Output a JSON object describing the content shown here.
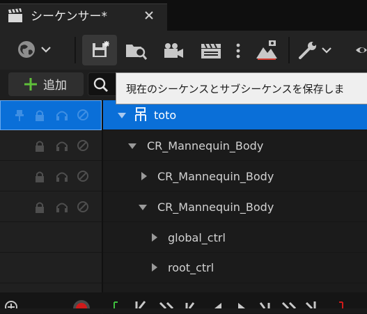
{
  "tab": {
    "title": "シーケンサー*",
    "icon": "clapperboard-icon"
  },
  "toolbar": {
    "buttons": [
      {
        "icon": "world-icon"
      },
      {
        "icon": "save-icon"
      },
      {
        "icon": "browse-icon"
      },
      {
        "icon": "camera-icon"
      },
      {
        "icon": "clapperboard-icon"
      },
      {
        "icon": "more-icon"
      },
      {
        "icon": "render-icon"
      },
      {
        "icon": "wrench-icon"
      },
      {
        "icon": "eye-icon"
      }
    ]
  },
  "filter": {
    "add_label": "追加"
  },
  "tooltip": {
    "text": "現在のシーケンスとサブシーケンスを保存しま"
  },
  "tree": {
    "rows": [
      {
        "label": "toto",
        "expanded": true,
        "selected": true,
        "icon": "sequence-icon"
      },
      {
        "label": "CR_Mannequin_Body",
        "expanded": true
      },
      {
        "label": "CR_Mannequin_Body",
        "expanded": false
      },
      {
        "label": "CR_Mannequin_Body",
        "expanded": true
      },
      {
        "label": "global_ctrl",
        "expanded": false
      },
      {
        "label": "root_ctrl",
        "expanded": false
      }
    ]
  },
  "colors": {
    "selection": "#0a6fd8",
    "add_icon": "#5fbf3a",
    "record": "#d01a1a"
  }
}
